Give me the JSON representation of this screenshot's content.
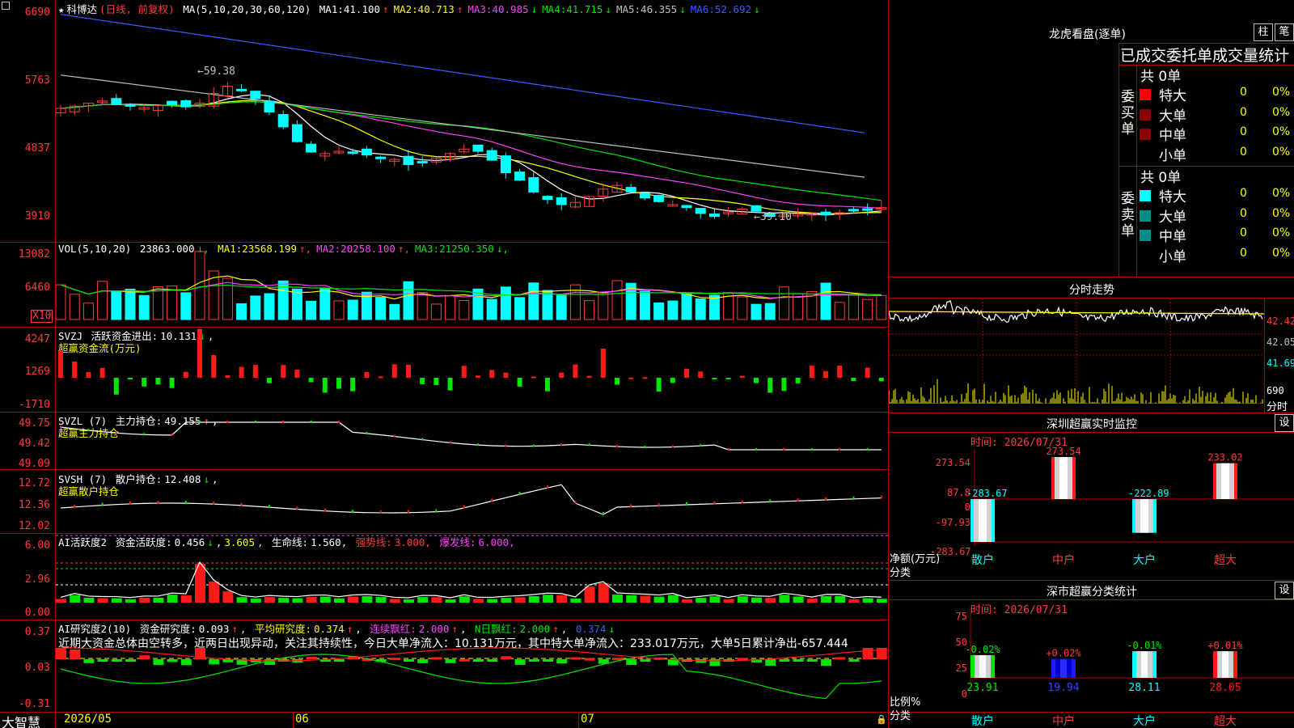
{
  "stock": {
    "name": "科博达",
    "period": "(日线, 前复权)",
    "ma_label": "MA(5,10,20,30,60,120)",
    "ma": [
      {
        "label": "MA1:",
        "value": "41.100",
        "dir": "↑",
        "color": "#ffffff"
      },
      {
        "label": "MA2:",
        "value": "40.713",
        "dir": "↑",
        "color": "#ffff00"
      },
      {
        "label": "MA3:",
        "value": "40.985",
        "dir": "↓",
        "color": "#ff40ff"
      },
      {
        "label": "MA4:",
        "value": "41.715",
        "dir": "↓",
        "color": "#00e600"
      },
      {
        "label": "MA5:",
        "value": "46.355",
        "dir": "↓",
        "color": "#c0c0c0"
      },
      {
        "label": "MA6:",
        "value": "52.692",
        "dir": "↓",
        "color": "#3a5cff"
      }
    ],
    "high_marker": "59.38",
    "low_marker": "39.10",
    "y_labels": [
      "6690",
      "5763",
      "4837",
      "3910"
    ]
  },
  "volume": {
    "title": "VOL(5,10,20)",
    "value": "23863.000",
    "ma": [
      {
        "label": "MA1:",
        "value": "23568.199",
        "dir": "↑",
        "color": "#ffff00"
      },
      {
        "label": "MA2:",
        "value": "20258.100",
        "dir": "↑",
        "color": "#ff40ff"
      },
      {
        "label": "MA3:",
        "value": "21250.350",
        "dir": "↓",
        "color": "#00e600"
      }
    ],
    "y_labels": [
      "13082",
      "6460"
    ],
    "unit": "X10"
  },
  "svzj": {
    "title": "SVZJ",
    "label": "活跃资金进出:",
    "value": "10.131",
    "dir": "↓",
    "subtitle": "超赢资金流(万元)",
    "y_labels": [
      "4247",
      "1269",
      "-1710"
    ]
  },
  "svzl": {
    "title": "SVZL (7)",
    "label": "主力持仓:",
    "value": "49.155",
    "dir": "↑",
    "subtitle": "超赢主力持仓",
    "y_labels": [
      "49.75",
      "49.42",
      "49.09"
    ]
  },
  "svsh": {
    "title": "SVSH (7)",
    "label": "散户持仓:",
    "value": "12.408",
    "dir": "↓",
    "subtitle": "超赢散户持仓",
    "y_labels": [
      "12.72",
      "12.36",
      "12.02"
    ]
  },
  "ai1": {
    "title": "AI活跃度2",
    "label": "资金活跃度:",
    "value": "0.456",
    "dir": "↓",
    "value2": "3.605",
    "life_label": "生命线:",
    "life_value": "1.560,",
    "strong_label": "强势线:",
    "strong_value": "3.000,",
    "burst_label": "爆发线:",
    "burst_value": "6.000,",
    "y_labels": [
      "6.00",
      "2.96",
      "0.00"
    ]
  },
  "ai2": {
    "title": "AI研究度2(10)",
    "label": "资金研究度:",
    "value": "0.093",
    "dir": "↑",
    "avg_label": "平均研究度:",
    "avg_value": "0.374",
    "avg_dir": "↑",
    "red1_label": "连续飘红:",
    "red1_value": "2.000",
    "red1_dir": "↑",
    "red2_label": "N日飘红:",
    "red2_value": "2.000",
    "red2_dir": "↑",
    "blue_value": "0.374",
    "blue_dir": "↓",
    "comment": "近期大资金总体由空转多，近两日出现异动，关注其持续性，今日大单净流入：10.131万元，其中特大单净流入：233.017万元，大单5日累计净出-657.444",
    "y_labels": [
      "0.37",
      "0.03",
      "-0.31"
    ]
  },
  "xaxis": {
    "brand": "大智慧",
    "labels": [
      "2026/05",
      "06",
      "07"
    ]
  },
  "longhu": {
    "title": "龙虎看盘(逐单)",
    "btn1": "柱",
    "btn2": "笔",
    "header": "已成交委托单成交量统计",
    "buy_label": "委买单",
    "sell_label": "委卖单",
    "buy_total": "共 0单",
    "sell_total": "共 0单",
    "buy_rows": [
      {
        "name": "特大",
        "count": "0",
        "pct": "0%",
        "color": "#ff0000"
      },
      {
        "name": "大单",
        "count": "0",
        "pct": "0%",
        "color": "#8b0000"
      },
      {
        "name": "中单",
        "count": "0",
        "pct": "0%",
        "color": "#8b0000"
      },
      {
        "name": "小单",
        "count": "0",
        "pct": "0%",
        "color": "#000000"
      }
    ],
    "sell_rows": [
      {
        "name": "特大",
        "count": "0",
        "pct": "0%",
        "color": "#00ffff"
      },
      {
        "name": "大单",
        "count": "0",
        "pct": "0%",
        "color": "#008b8b"
      },
      {
        "name": "中单",
        "count": "0",
        "pct": "0%",
        "color": "#008b8b"
      },
      {
        "name": "小单",
        "count": "0",
        "pct": "0%",
        "color": "#000000"
      }
    ]
  },
  "intraday": {
    "title": "分时走势",
    "price_labels": [
      "42.42",
      "42.05",
      "41.69"
    ],
    "vol_label": "690",
    "time_label": "分时"
  },
  "monitor": {
    "title": "深圳超赢实时监控",
    "settings": "设",
    "time": "时间: 2026/07/31",
    "y_labels": [
      "273.54",
      "87.8",
      "0",
      "-97.93",
      "-283.67"
    ],
    "unit_label": "净额(万元)",
    "cat_label": "分类",
    "chart_data": {
      "type": "bar",
      "categories": [
        "散户",
        "中户",
        "大户",
        "超大"
      ],
      "values": [
        -283.67,
        273.54,
        -222.89,
        233.02
      ],
      "value_labels": [
        "-283.67",
        "273.54",
        "-222.89",
        "233.02"
      ],
      "ylim": [
        -283.67,
        273.54
      ]
    }
  },
  "classify": {
    "title": "深市超赢分类统计",
    "settings": "设",
    "time": "时间: 2026/07/31",
    "y_labels": [
      "75",
      "50",
      "25",
      "0"
    ],
    "ratio_label": "比例%",
    "cat_label": "分类",
    "chart_data": {
      "type": "bar",
      "categories": [
        "散户",
        "中户",
        "大户",
        "超大"
      ],
      "values": [
        23.91,
        19.94,
        28.11,
        28.05
      ],
      "changes": [
        "-0.02%",
        "+0.02%",
        "-0.01%",
        "+0.01%"
      ],
      "value_labels": [
        "23.91",
        "19.94",
        "28.11",
        "28.05"
      ],
      "ylim": [
        0,
        75
      ]
    }
  }
}
